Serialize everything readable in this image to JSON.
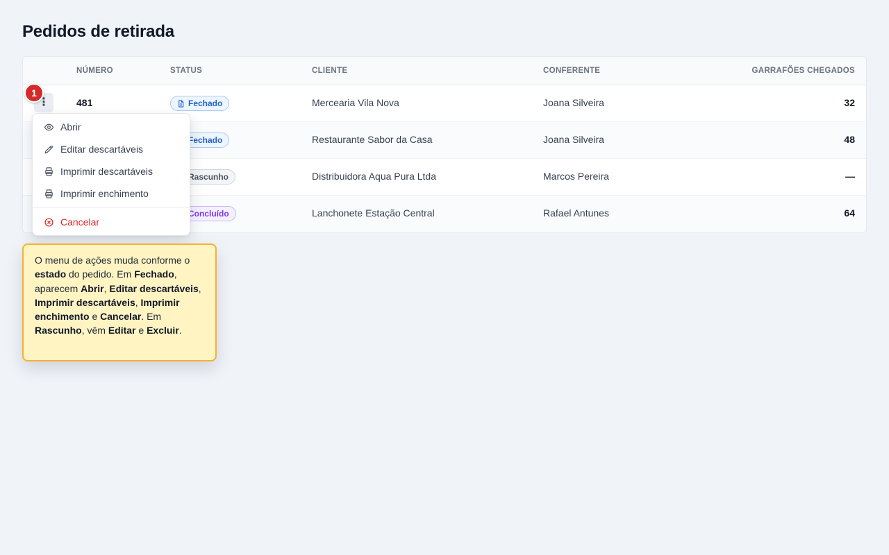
{
  "page": {
    "title": "Pedidos de retirada"
  },
  "table": {
    "headers": {
      "numero": "NÚMERO",
      "status": "STATUS",
      "cliente": "CLIENTE",
      "conferente": "CONFERENTE",
      "garrafoes": "GARRAFÕES CHEGADOS"
    },
    "rows": [
      {
        "numero": "481",
        "status": "Fechado",
        "cliente": "Mercearia Vila Nova",
        "conferente": "Joana Silveira",
        "garrafoes": "32"
      },
      {
        "numero": "",
        "status": "Fechado",
        "cliente": "Restaurante Sabor da Casa",
        "conferente": "Joana Silveira",
        "garrafoes": "48"
      },
      {
        "numero": "",
        "status": "Rascunho",
        "cliente": "Distribuidora Aqua Pura Ltda",
        "conferente": "Marcos Pereira",
        "garrafoes": "—"
      },
      {
        "numero": "",
        "status": "Concluído",
        "cliente": "Lanchonete Estação Central",
        "conferente": "Rafael Antunes",
        "garrafoes": "64"
      }
    ]
  },
  "step_badge": "1",
  "kebab_icon": "⋮",
  "menu": {
    "items": [
      {
        "label": "Abrir",
        "icon": "eye-icon"
      },
      {
        "label": "Editar descartáveis",
        "icon": "pencil-icon"
      },
      {
        "label": "Imprimir descartáveis",
        "icon": "printer-icon"
      },
      {
        "label": "Imprimir enchimento",
        "icon": "printer-icon"
      }
    ],
    "cancel": {
      "label": "Cancelar",
      "icon": "x-circle-icon"
    }
  },
  "callout": {
    "t1": "O menu de ações muda conforme o ",
    "b1": "estado",
    "t2": " do pedido. Em ",
    "b2": "Fechado",
    "t3": ", aparecem ",
    "b3": "Abrir",
    "t4": ", ",
    "b4": "Editar descartáveis",
    "t5": ", ",
    "b5": "Imprimir descartáveis",
    "t6": ", ",
    "b6": "Imprimir enchimento",
    "t7": " e ",
    "b7": "Cancelar",
    "t8": ". Em ",
    "b8": "Rascunho",
    "t9": ", vêm ",
    "b9": "Editar",
    "t10": " e ",
    "b10": "Excluir",
    "t11": "."
  },
  "colors": {
    "accent_blue": "#1d64c8",
    "danger": "#dc2626",
    "callout_bg": "#fff4c2",
    "callout_border": "#f2b233"
  }
}
